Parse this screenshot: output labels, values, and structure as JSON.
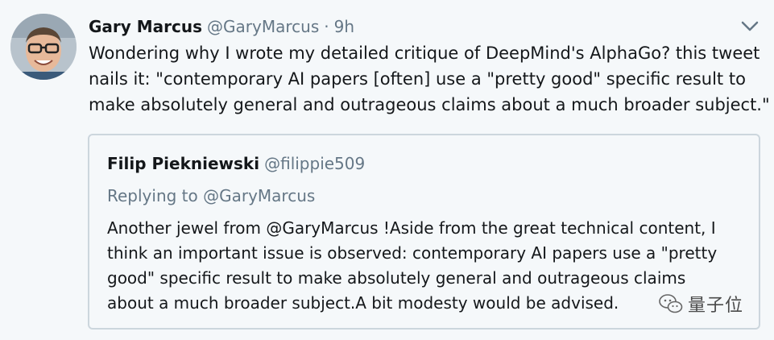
{
  "tweet": {
    "author_name": "Gary Marcus",
    "author_handle": "@GaryMarcus",
    "separator": "·",
    "time": "9h",
    "text_lines": [
      "Wondering why I wrote my detailed critique of DeepMind's AlphaGo?  this tweet",
      "nails it: \"contemporary AI papers [often] use a \"pretty good\" specific result to",
      "make absolutely general and outrageous claims about a much broader subject.\""
    ],
    "menu_icon": "chevron-down-icon",
    "avatar_icon": "avatar-photo"
  },
  "quoted": {
    "author_name": "Filip Piekniewski",
    "author_handle": "@filippie509",
    "reply_line": "Replying to @GaryMarcus",
    "text_lines": [
      "Another jewel from @GaryMarcus !Aside from the great technical content, I",
      "think an important issue is observed: contemporary AI papers use a \"pretty",
      "good\" specific result to make absolutely general and outrageous claims",
      "about a much broader subject.A bit modesty would be advised."
    ]
  },
  "watermark": {
    "text": "量子位",
    "icon": "wechat-icon"
  }
}
